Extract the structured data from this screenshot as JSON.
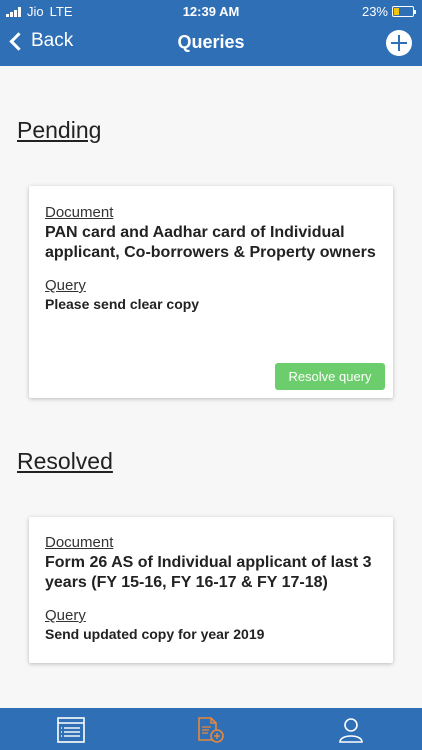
{
  "status_bar": {
    "carrier": "Jio",
    "network": "LTE",
    "time": "12:39 AM",
    "battery": "23%",
    "battery_level": 0.23
  },
  "nav": {
    "back_label": "Back",
    "title": "Queries",
    "add_icon": "plus-circle-icon"
  },
  "sections": {
    "pending": {
      "title": "Pending",
      "card": {
        "document_label": "Document",
        "document_value": "PAN card and Aadhar card of Individual applicant, Co-borrowers & Property owners",
        "query_label": "Query",
        "query_value": "Please send clear copy",
        "button_label": "Resolve query"
      }
    },
    "resolved": {
      "title": "Resolved",
      "card": {
        "document_label": "Document",
        "document_value": "Form 26 AS of Individual applicant of last 3 years (FY 15-16, FY 16-17 & FY 17-18)",
        "query_label": "Query",
        "query_value": "Send updated copy for year 2019"
      }
    }
  },
  "tabbar": {
    "tabs": [
      {
        "icon": "list-document-icon",
        "active": false
      },
      {
        "icon": "add-document-icon",
        "active": true
      },
      {
        "icon": "profile-icon",
        "active": false
      }
    ],
    "active_color": "#e8873a"
  },
  "colors": {
    "primary": "#2f6fb6",
    "resolve_button": "#6ccd6c",
    "background": "#f7f7f7"
  }
}
